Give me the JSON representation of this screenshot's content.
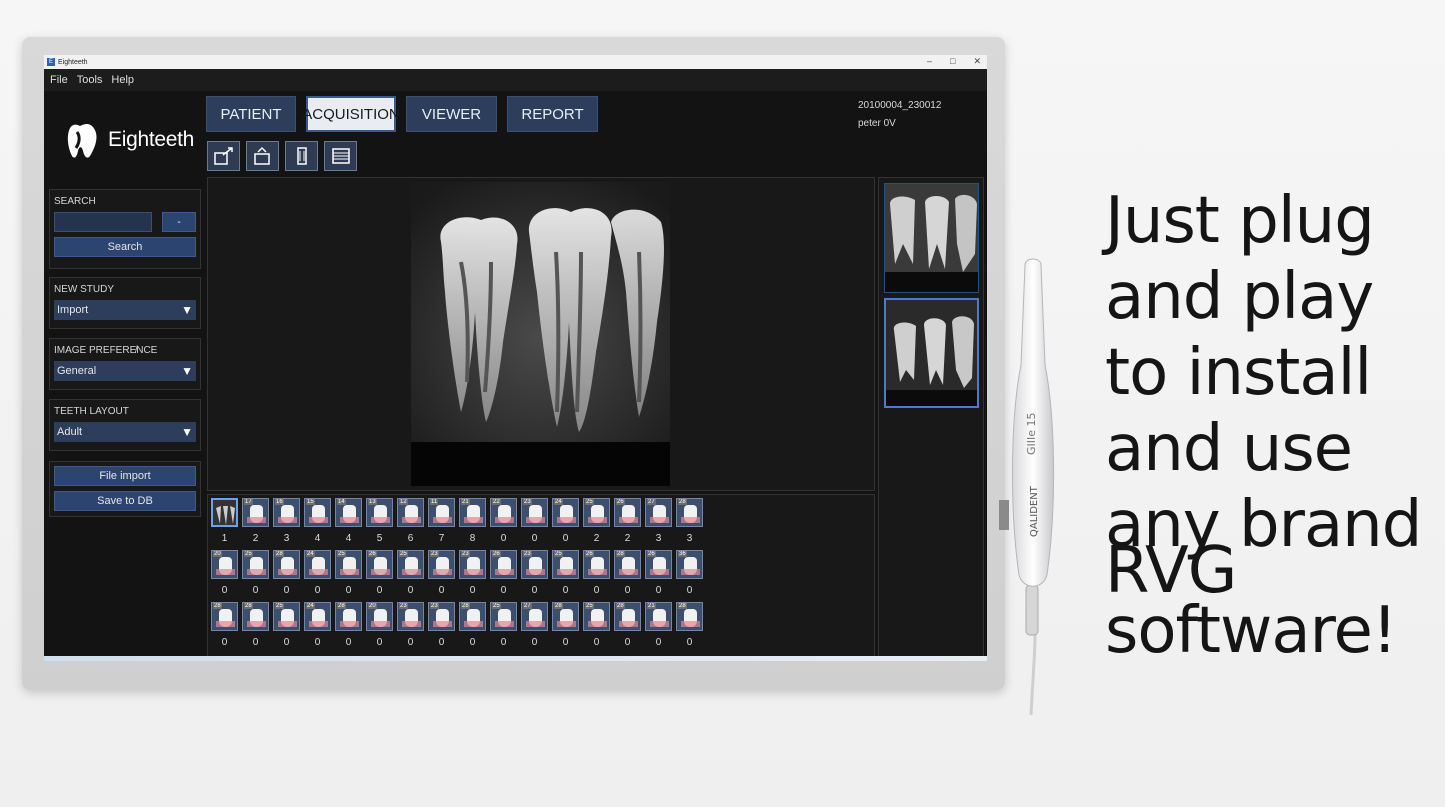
{
  "window": {
    "title": "Eighteeth",
    "controls": [
      "–",
      "□",
      "✕"
    ]
  },
  "menu": [
    "File",
    "Tools",
    "Help"
  ],
  "brand": {
    "name": "Eighteeth"
  },
  "nav": {
    "tabs": [
      "PATIENT",
      "ACQUISITION",
      "VIEWER",
      "REPORT"
    ],
    "active": "ACQUISITION"
  },
  "patient": {
    "study_id": "20100004_230012",
    "name": "peter 0V"
  },
  "toolbar": {
    "icons": [
      "acquire-icon",
      "rotate-icon",
      "sensor-icon",
      "list-icon"
    ]
  },
  "search": {
    "label": "SEARCH",
    "minus_label": "-",
    "button": "Search",
    "value": ""
  },
  "new_study": {
    "label": "NEW STUDY",
    "value": "Import"
  },
  "image_pref": {
    "label": "IMAGE PREFERE̸NCE",
    "value": "General"
  },
  "teeth_layout": {
    "label": "TEETH LAYOUT",
    "value": "Adult"
  },
  "actions": {
    "file_import": "File import",
    "save_db": "Save to DB"
  },
  "teeth": {
    "row1": {
      "ids": [
        "",
        "18",
        "17",
        "16",
        "15",
        "14",
        "13",
        "12",
        "11",
        "21",
        "22",
        "23",
        "24",
        "25",
        "26",
        "27",
        "28"
      ],
      "counts": [
        "1",
        "2",
        "3",
        "4",
        "4",
        "5",
        "6",
        "7",
        "8",
        "0",
        "0",
        "0",
        "2",
        "2",
        "3",
        "3"
      ]
    },
    "row2": {
      "ids": [
        "20",
        "25",
        "28",
        "24",
        "25",
        "26",
        "25",
        "23",
        "23",
        "26",
        "23",
        "25",
        "26",
        "28",
        "26",
        "36"
      ],
      "counts": [
        "0",
        "0",
        "0",
        "0",
        "0",
        "0",
        "0",
        "0",
        "0",
        "0",
        "0",
        "0",
        "0",
        "0",
        "0",
        "0"
      ]
    },
    "row3": {
      "ids": [
        "28",
        "28",
        "25",
        "24",
        "28",
        "20",
        "23",
        "23",
        "28",
        "25",
        "27",
        "28",
        "25",
        "28",
        "21",
        "28"
      ],
      "counts": [
        "0",
        "0",
        "0",
        "0",
        "0",
        "0",
        "0",
        "0",
        "0",
        "0",
        "0",
        "0",
        "0",
        "0",
        "0",
        "0"
      ]
    }
  },
  "headline": [
    "Just plug",
    "and play",
    "to install",
    "and use",
    "any brand",
    "RVG",
    "software!"
  ],
  "probe": {
    "brand": "QALIDENT",
    "model": "GIIIe 15"
  },
  "colors": {
    "nav_bg": "#2c3e5c",
    "accent": "#4b7ad0",
    "screen_bg": "#131313"
  }
}
